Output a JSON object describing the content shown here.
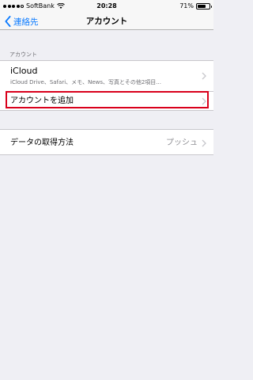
{
  "status_bar": {
    "carrier": "SoftBank",
    "time": "20:28",
    "battery_percent": "71%",
    "battery_level": 0.71,
    "signal_bars_filled": 4
  },
  "nav": {
    "back_label": "連絡先",
    "title": "アカウント"
  },
  "accounts_section": {
    "header": "アカウント",
    "icloud": {
      "title": "iCloud",
      "subtitle": "iCloud Drive、Safari、メモ、News、写真とその他2項目..."
    },
    "add_account_label": "アカウントを追加"
  },
  "fetch_section": {
    "label": "データの取得方法",
    "value": "プッシュ"
  },
  "colors": {
    "accent": "#0a7aff",
    "highlight": "#d9001b",
    "background": "#efeff4"
  }
}
